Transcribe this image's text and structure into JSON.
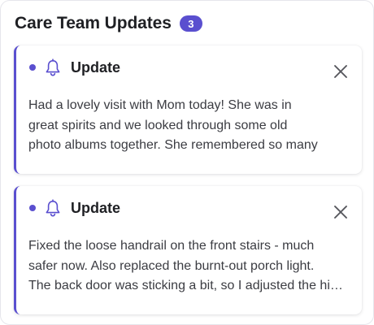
{
  "header": {
    "title": "Care Team Updates",
    "count": "3"
  },
  "colors": {
    "accent": "#5a4fcf",
    "text": "#1f2024",
    "body_text": "#3b3c42"
  },
  "updates": [
    {
      "title": "Update",
      "unread": true,
      "icon": "bell-icon",
      "lines": [
        "Had a lovely visit with Mom today! She was in",
        "great spirits and we looked through some old",
        "photo albums together. She remembered so many"
      ]
    },
    {
      "title": "Update",
      "unread": true,
      "icon": "bell-icon",
      "lines": [
        "Fixed the loose handrail on the front stairs - much",
        "safer now. Also replaced the burnt-out porch light.",
        "The back door was sticking a bit, so I adjusted the hinges"
      ]
    }
  ]
}
